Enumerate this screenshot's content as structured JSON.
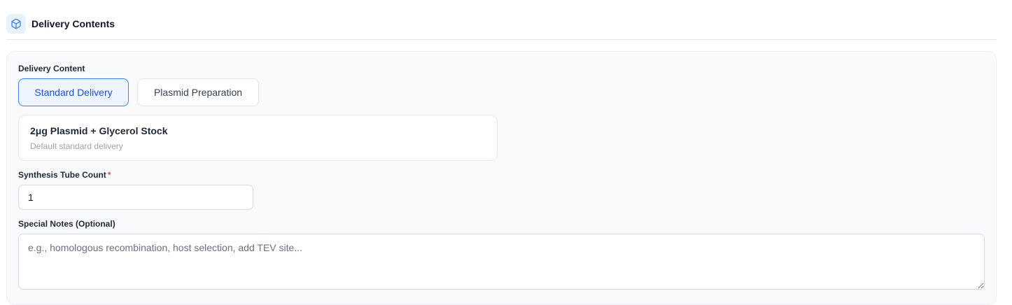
{
  "section": {
    "title": "Delivery Contents",
    "icon": "package-icon"
  },
  "delivery_content": {
    "label": "Delivery Content",
    "options": [
      {
        "label": "Standard Delivery",
        "selected": true
      },
      {
        "label": "Plasmid Preparation",
        "selected": false
      }
    ],
    "selected_detail": {
      "title": "2μg Plasmid + Glycerol Stock",
      "subtitle": "Default standard delivery"
    }
  },
  "tube_count": {
    "label": "Synthesis Tube Count",
    "required_mark": "*",
    "value": "1"
  },
  "notes": {
    "label": "Special Notes (Optional)",
    "placeholder": "e.g., homologous recombination, host selection, add TEV site...",
    "value": ""
  },
  "colors": {
    "accent": "#3b82f6",
    "accent_text": "#1d4ed8",
    "required": "#ef4444"
  }
}
